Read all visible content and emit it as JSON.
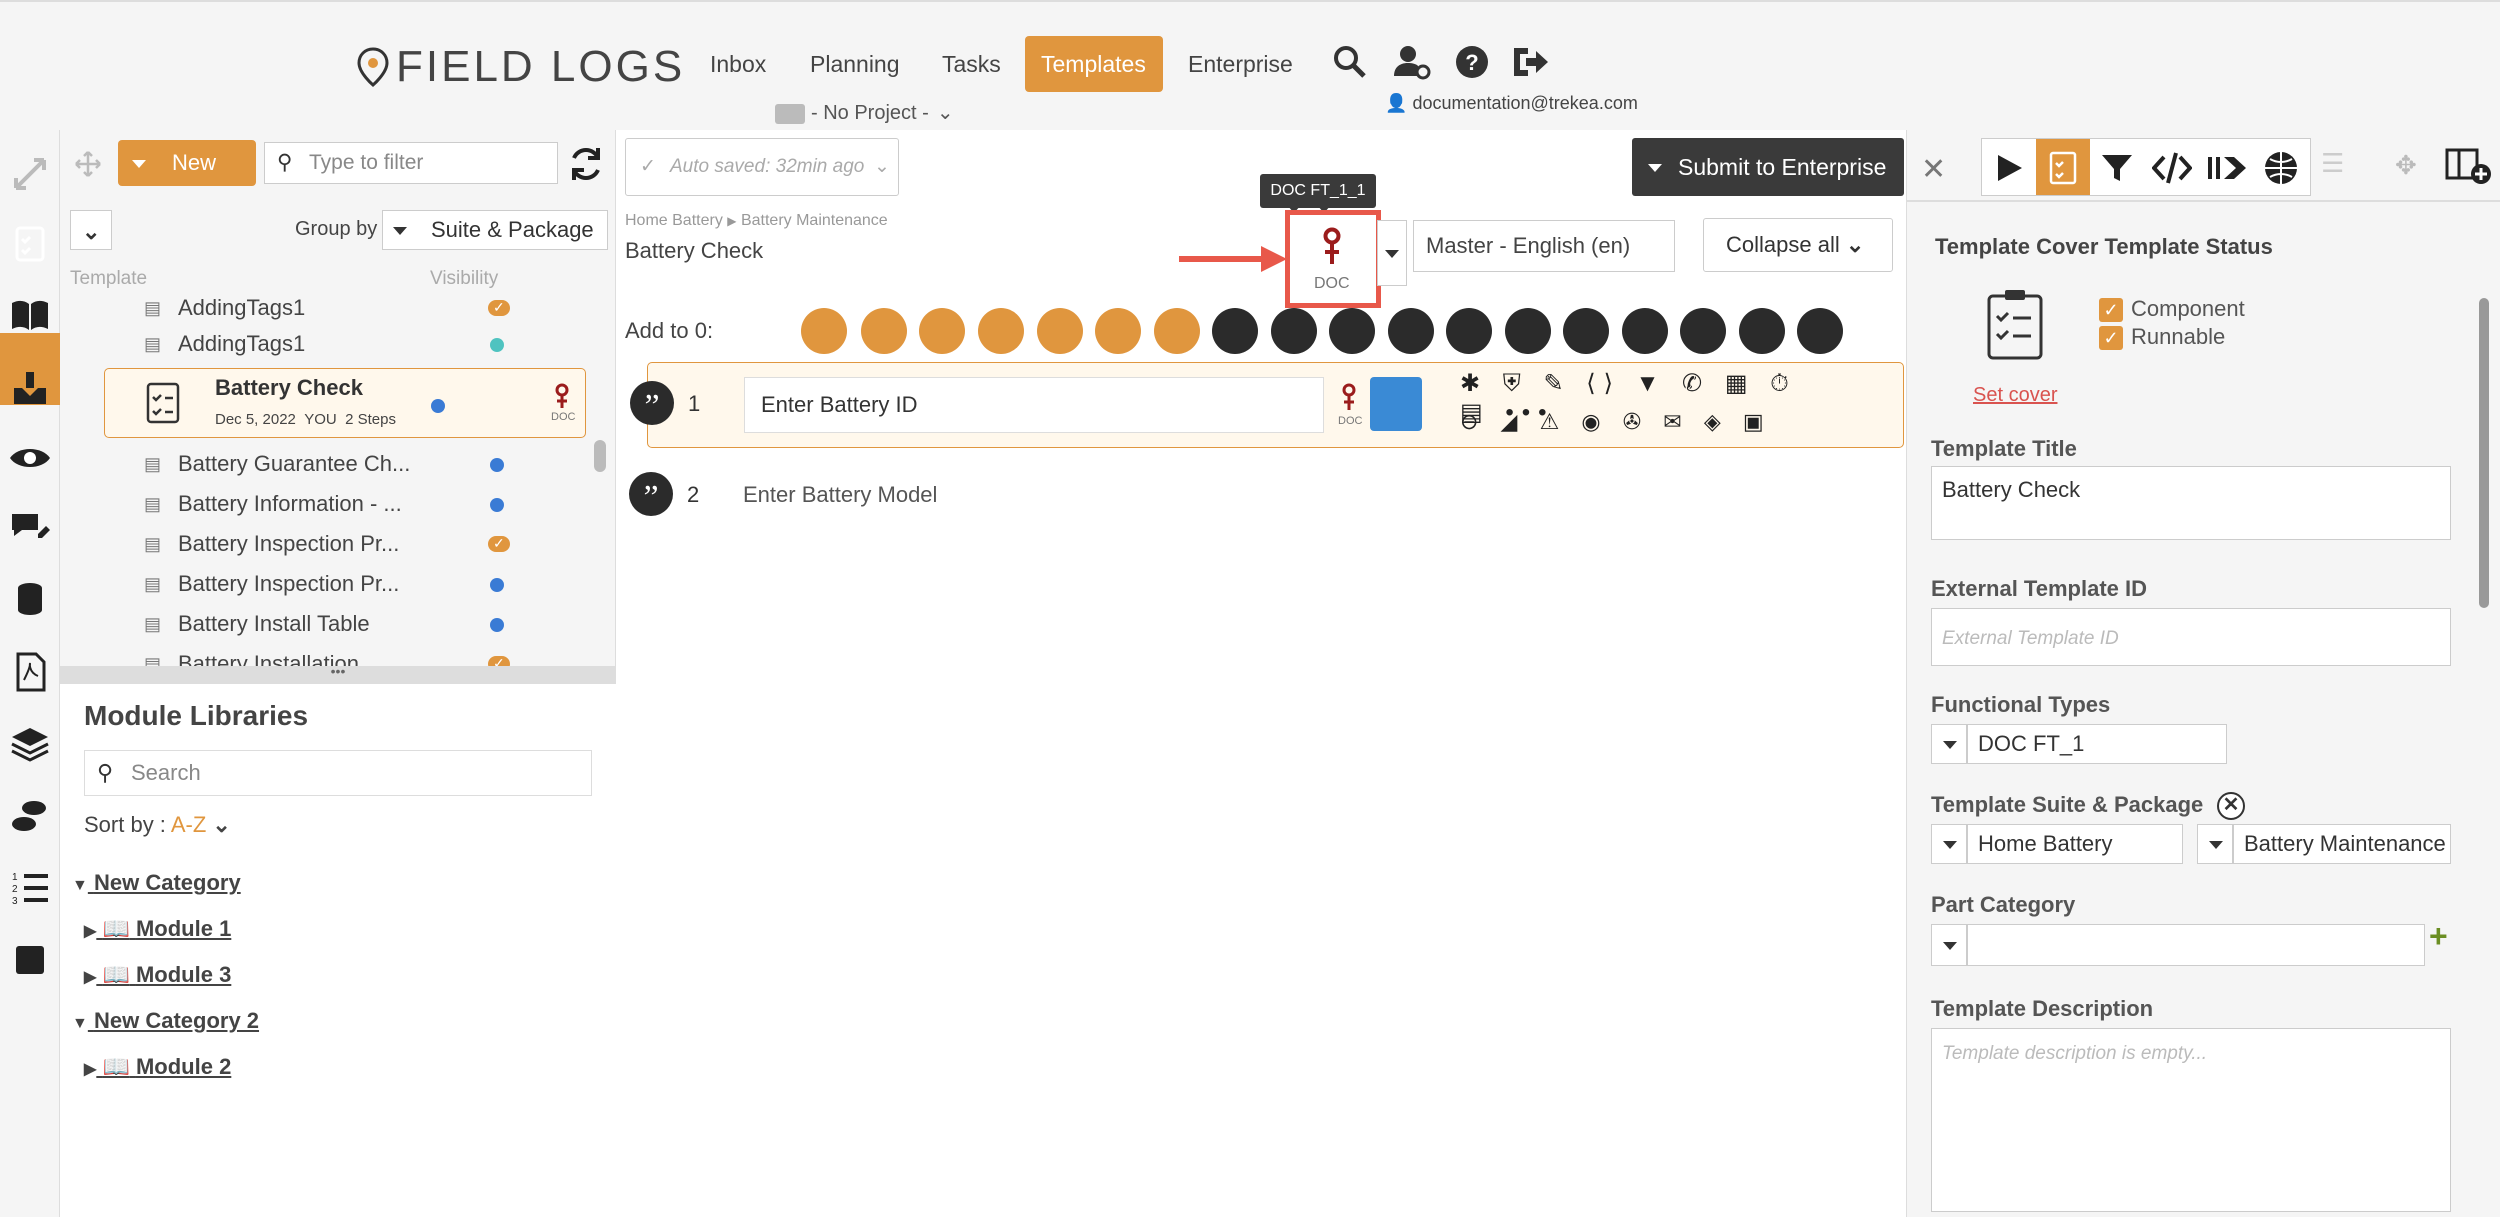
{
  "brand": "FIELD LOGS",
  "nav": {
    "items": [
      "Inbox",
      "Planning",
      "Tasks",
      "Templates",
      "Enterprise"
    ],
    "active": "Templates",
    "project": "- No Project -",
    "user_email": "documentation@trekea.com"
  },
  "list": {
    "new_label": "New",
    "filter_placeholder": "Type to filter",
    "group_by_label": "Group by",
    "group_by_value": "Suite & Package",
    "col_template": "Template",
    "col_visibility": "Visibility",
    "items": [
      {
        "name": "AddingTags1",
        "vis": "check"
      },
      {
        "name": "AddingTags1",
        "vis": "teal"
      },
      {
        "name": "Battery Guarantee Ch...",
        "vis": "blue"
      },
      {
        "name": "Battery Information - ...",
        "vis": "blue"
      },
      {
        "name": "Battery Inspection Pr...",
        "vis": "check"
      },
      {
        "name": "Battery Inspection Pr...",
        "vis": "blue"
      },
      {
        "name": "Battery Install Table",
        "vis": "blue"
      },
      {
        "name": "Battery Installation",
        "vis": "check"
      }
    ],
    "selected": {
      "name": "Battery Check",
      "date": "Dec 5, 2022",
      "owner": "YOU",
      "steps": "2 Steps",
      "doc": "DOC"
    }
  },
  "modules": {
    "title": "Module Libraries",
    "search_placeholder": "Search",
    "sort_label": "Sort by :",
    "sort_value": "A-Z",
    "cat1": "New Category",
    "mod1": "Module 1",
    "mod3": "Module 3",
    "cat2": "New Category 2",
    "mod2": "Module 2"
  },
  "center": {
    "autosave": "Auto saved: 32min ago",
    "submit": "Submit to Enterprise",
    "breadcrumb_1": "Home Battery",
    "breadcrumb_2": "Battery Maintenance",
    "title": "Battery Check",
    "tooltip": "DOC FT_1_1",
    "doc_label": "DOC",
    "language": "Master - English (en)",
    "collapse": "Collapse all",
    "add_to": "Add to 0:",
    "steps": [
      {
        "num": "1",
        "text": "Enter Battery ID",
        "doc": "DOC"
      },
      {
        "num": "2",
        "text": "Enter Battery Model"
      }
    ]
  },
  "right": {
    "cover_header": "Template Cover Template Status",
    "component": "Component",
    "runnable": "Runnable",
    "set_cover": "Set cover",
    "title_label": "Template Title",
    "title_value": "Battery Check",
    "ext_label": "External Template ID",
    "ext_placeholder": "External Template ID",
    "ft_label": "Functional Types",
    "ft_value": "DOC FT_1",
    "suite_label": "Template Suite & Package",
    "suite_value": "Home Battery",
    "package_value": "Battery Maintenance",
    "part_label": "Part Category",
    "desc_label": "Template Description",
    "desc_placeholder": "Template description is empty..."
  },
  "colors": {
    "accent": "#e0963e",
    "dark": "#2b2b2b",
    "doc_red": "#9b1c1c",
    "highlight": "#e8584a"
  }
}
